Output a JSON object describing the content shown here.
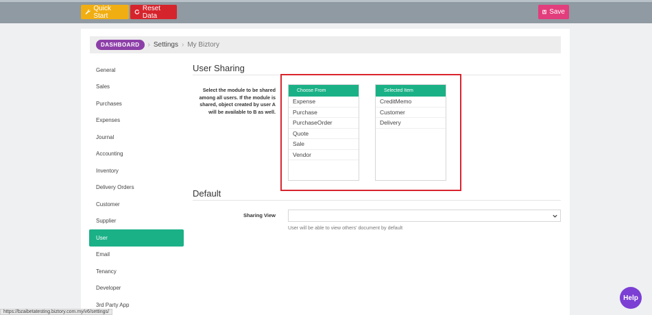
{
  "toolbar": {
    "quick_start_label": "Quick Start",
    "quick_start_icon": "wrench-icon",
    "reset_label": "Reset Data",
    "reset_icon": "refresh-icon",
    "save_label": "Save",
    "save_icon": "floppy-disk-icon"
  },
  "breadcrumb": {
    "dashboard": "DASHBOARD",
    "settings": "Settings",
    "current": "My Biztory"
  },
  "sidebar": {
    "items": [
      {
        "label": "General"
      },
      {
        "label": "Sales"
      },
      {
        "label": "Purchases"
      },
      {
        "label": "Expenses"
      },
      {
        "label": "Journal"
      },
      {
        "label": "Accounting"
      },
      {
        "label": "Inventory"
      },
      {
        "label": "Delivery Orders"
      },
      {
        "label": "Customer"
      },
      {
        "label": "Supplier"
      },
      {
        "label": "User",
        "active": true
      },
      {
        "label": "Email"
      },
      {
        "label": "Tenancy"
      },
      {
        "label": "Developer"
      },
      {
        "label": "3rd Party App"
      }
    ]
  },
  "user_sharing": {
    "title": "User Sharing",
    "description": "Select the module to be shared among all users. If the module is shared, object created by user A will be available to B as well.",
    "choose_from": {
      "header": "Choose From",
      "items": [
        "Expense",
        "Purchase",
        "PurchaseOrder",
        "Quote",
        "Sale",
        "Vendor"
      ]
    },
    "selected": {
      "header": "Selected Item",
      "items": [
        "CreditMemo",
        "Customer",
        "Delivery"
      ]
    }
  },
  "default_section": {
    "title": "Default",
    "sharing_view_label": "Sharing View",
    "sharing_view_value": "",
    "help_text": "User will be able to view others' document by default"
  },
  "status_url": "https://bzaibetatesting.biztory.com.my/v6/settings/",
  "help_label": "Help",
  "colors": {
    "accent_green": "#1ab187",
    "quick_start": "#f1ae12",
    "reset": "#d6242c",
    "save": "#e23d7c",
    "dashboard_badge": "#8d3fa8",
    "highlight": "#d9232d",
    "help": "#7b3fd4"
  }
}
